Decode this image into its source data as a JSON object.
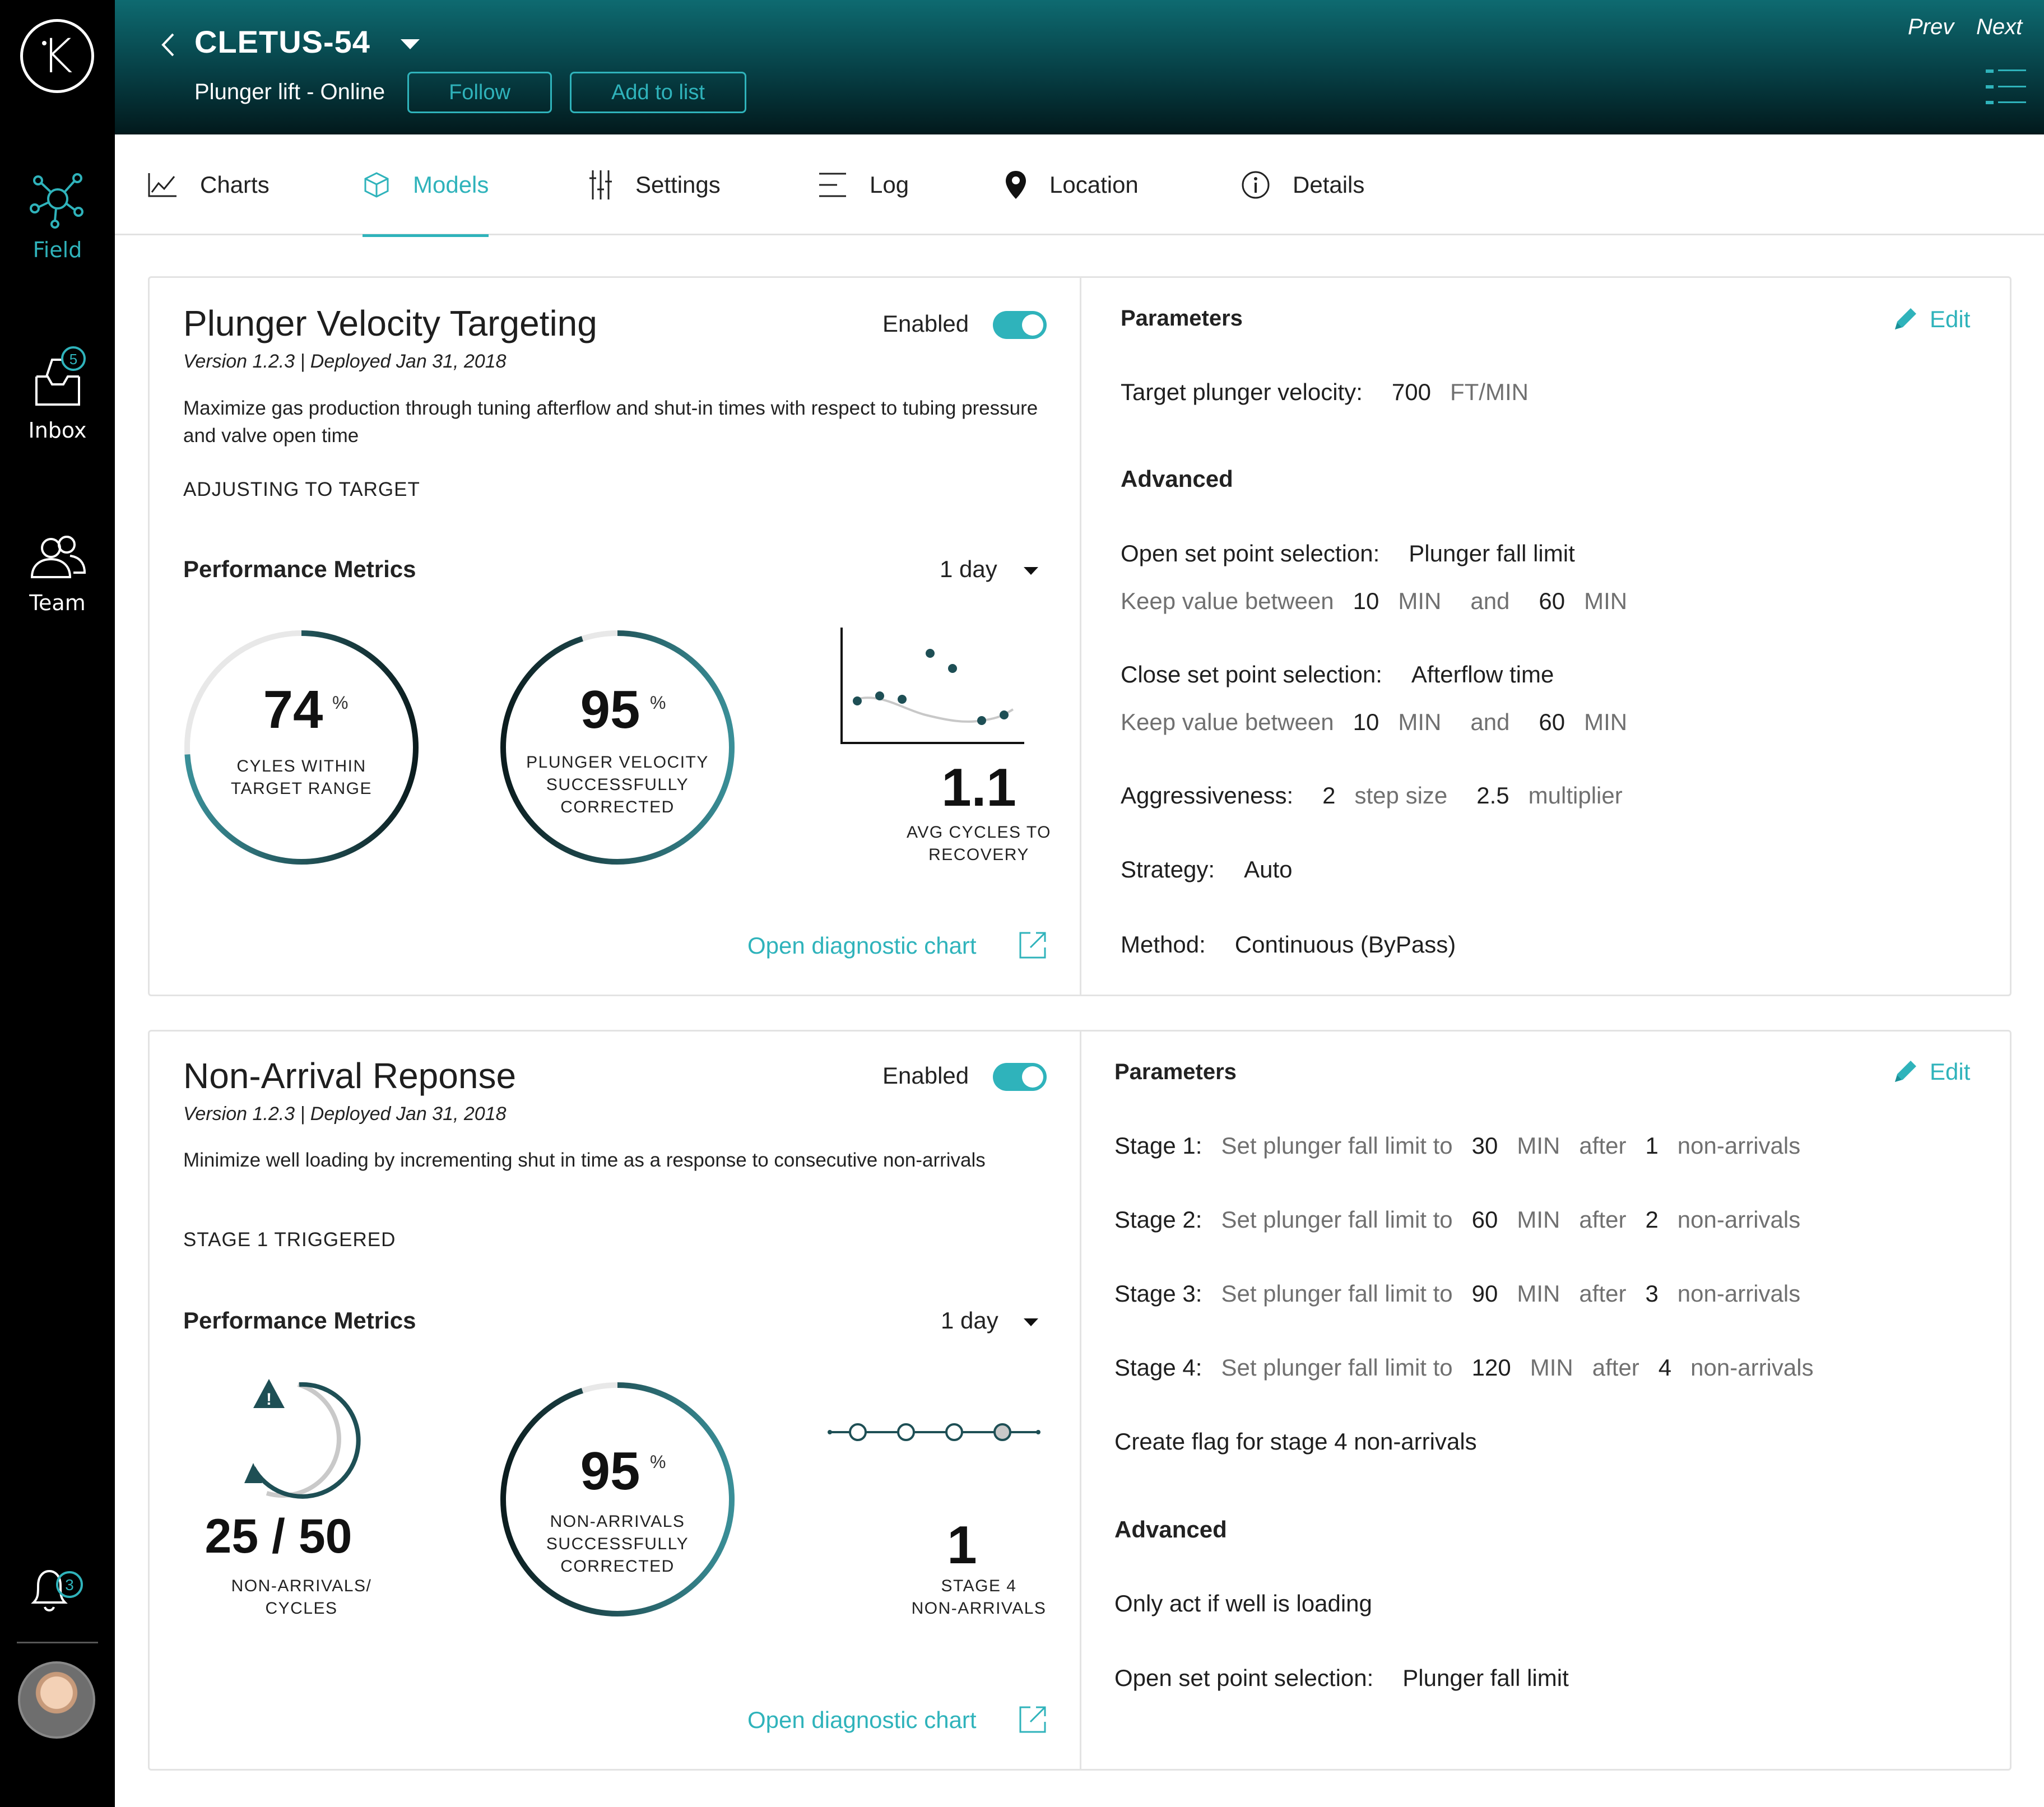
{
  "sidebar": {
    "logo_letter": "K",
    "items": [
      {
        "label": "Field",
        "icon": "network-icon"
      },
      {
        "label": "Inbox",
        "icon": "inbox-icon",
        "badge": "5"
      },
      {
        "label": "Team",
        "icon": "team-icon"
      }
    ],
    "notifications_count": "3"
  },
  "header": {
    "well_name": "CLETUS-54",
    "subtitle": "Plunger lift - Online",
    "follow_label": "Follow",
    "add_to_list_label": "Add to list",
    "prev_label": "Prev",
    "next_label": "Next"
  },
  "tabs": [
    {
      "label": "Charts",
      "icon": "line-chart-icon"
    },
    {
      "label": "Models",
      "icon": "cube-icon",
      "active": true
    },
    {
      "label": "Settings",
      "icon": "sliders-icon"
    },
    {
      "label": "Log",
      "icon": "log-list-icon"
    },
    {
      "label": "Location",
      "icon": "map-pin-icon"
    },
    {
      "label": "Details",
      "icon": "info-icon"
    }
  ],
  "colors": {
    "accent": "#2fb3bb",
    "ring_dark": "#0b1c1e",
    "ring_teal": "#3a8f98"
  },
  "models": [
    {
      "title": "Plunger Velocity Targeting",
      "version": "Version 1.2.3 | Deployed Jan 31, 2018",
      "description": "Maximize gas production through tuning afterflow and shut-in times with respect to tubing pressure and valve open time",
      "status": "ADJUSTING TO TARGET",
      "enabled_label": "Enabled",
      "enabled": true,
      "metrics_title": "Performance Metrics",
      "period": "1 day",
      "metrics": [
        {
          "value": "74",
          "unit": "%",
          "fraction": 0.74,
          "label_lines": [
            "CYLES WITHIN",
            "TARGET RANGE"
          ]
        },
        {
          "value": "95",
          "unit": "%",
          "fraction": 0.95,
          "label_lines": [
            "PLUNGER VELOCITY",
            "SUCCESSFULLY",
            "CORRECTED"
          ]
        },
        {
          "value": "1.1",
          "label_lines": [
            "AVG CYCLES TO",
            "RECOVERY"
          ]
        }
      ],
      "diagnostic_link": "Open diagnostic chart",
      "parameters": {
        "title": "Parameters",
        "edit_label": "Edit",
        "target": {
          "label": "Target plunger velocity:",
          "value": "700",
          "unit": "FT/MIN"
        },
        "advanced_title": "Advanced",
        "open_sel": {
          "label": "Open set point selection:",
          "value": "Plunger fall limit"
        },
        "open_range": {
          "prefix": "Keep value between",
          "min": "10",
          "min_unit": "MIN",
          "and": "and",
          "max": "60",
          "max_unit": "MIN"
        },
        "close_sel": {
          "label": "Close set point selection:",
          "value": "Afterflow time"
        },
        "close_range": {
          "prefix": "Keep value between",
          "min": "10",
          "min_unit": "MIN",
          "and": "and",
          "max": "60",
          "max_unit": "MIN"
        },
        "aggressiveness": {
          "label": "Aggressiveness:",
          "step": "2",
          "step_label": "step size",
          "mult": "2.5",
          "mult_label": "multiplier"
        },
        "strategy": {
          "label": "Strategy:",
          "value": "Auto"
        },
        "method": {
          "label": "Method:",
          "value": "Continuous (ByPass)"
        }
      }
    },
    {
      "title": "Non-Arrival Reponse",
      "version": "Version 1.2.3 | Deployed Jan 31, 2018",
      "description": "Minimize well loading by incrementing shut in time as a response to consecutive non-arrivals",
      "status": "STAGE 1 TRIGGERED",
      "enabled_label": "Enabled",
      "enabled": true,
      "metrics_title": "Performance Metrics",
      "period": "1 day",
      "metrics": [
        {
          "value": "25 / 50",
          "label_lines": [
            "NON-ARRIVALS/",
            "CYCLES"
          ]
        },
        {
          "value": "95",
          "unit": "%",
          "fraction": 0.95,
          "label_lines": [
            "NON-ARRIVALS",
            "SUCCESSFULLY",
            "CORRECTED"
          ]
        },
        {
          "value": "1",
          "label_lines": [
            "STAGE 4",
            "NON-ARRIVALS"
          ]
        }
      ],
      "diagnostic_link": "Open diagnostic chart",
      "parameters": {
        "title": "Parameters",
        "edit_label": "Edit",
        "stages": [
          {
            "label": "Stage 1:",
            "text": "Set plunger fall limit to",
            "value": "30",
            "unit": "MIN",
            "after": "after",
            "count": "1",
            "suffix": "non-arrivals"
          },
          {
            "label": "Stage 2:",
            "text": "Set plunger fall limit to",
            "value": "60",
            "unit": "MIN",
            "after": "after",
            "count": "2",
            "suffix": "non-arrivals"
          },
          {
            "label": "Stage 3:",
            "text": "Set plunger fall limit to",
            "value": "90",
            "unit": "MIN",
            "after": "after",
            "count": "3",
            "suffix": "non-arrivals"
          },
          {
            "label": "Stage 4:",
            "text": "Set plunger fall limit to",
            "value": "120",
            "unit": "MIN",
            "after": "after",
            "count": "4",
            "suffix": "non-arrivals"
          }
        ],
        "flag": "Create flag for stage 4 non-arrivals",
        "advanced_title": "Advanced",
        "only_act": "Only act if well is loading",
        "open_sel": {
          "label": "Open set point selection:",
          "value": "Plunger fall limit"
        }
      }
    }
  ]
}
